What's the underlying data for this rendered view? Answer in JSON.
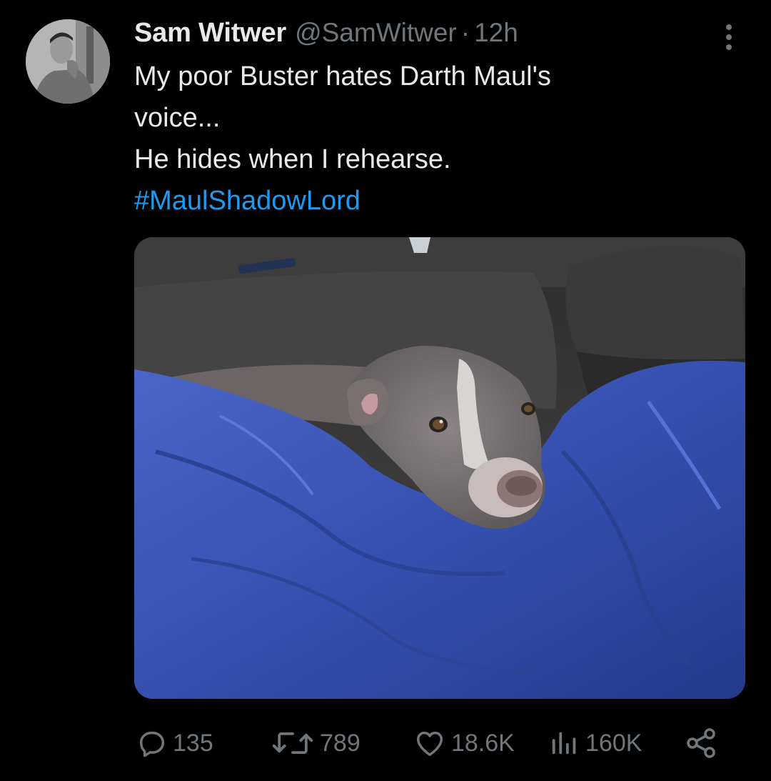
{
  "author": {
    "display_name": "Sam Witwer",
    "handle": "@SamWitwer",
    "separator": "·",
    "timestamp": "12h"
  },
  "tweet": {
    "lines": [
      "My poor Buster hates Darth Maul's",
      "voice...",
      "He hides when I rehearse."
    ],
    "hashtag": "#MaulShadowLord"
  },
  "stats": {
    "replies": "135",
    "retweets": "789",
    "likes": "18.6K",
    "views": "160K"
  },
  "icons": {
    "more": "more-vertical-icon",
    "reply": "reply-icon",
    "retweet": "retweet-icon",
    "like": "heart-icon",
    "views": "bar-chart-icon",
    "share": "share-icon"
  },
  "colors": {
    "background": "#000000",
    "primary_text": "#e7e9ea",
    "secondary_text": "#71767b",
    "link": "#1d9bf0",
    "blanket": "#3a55b5"
  }
}
